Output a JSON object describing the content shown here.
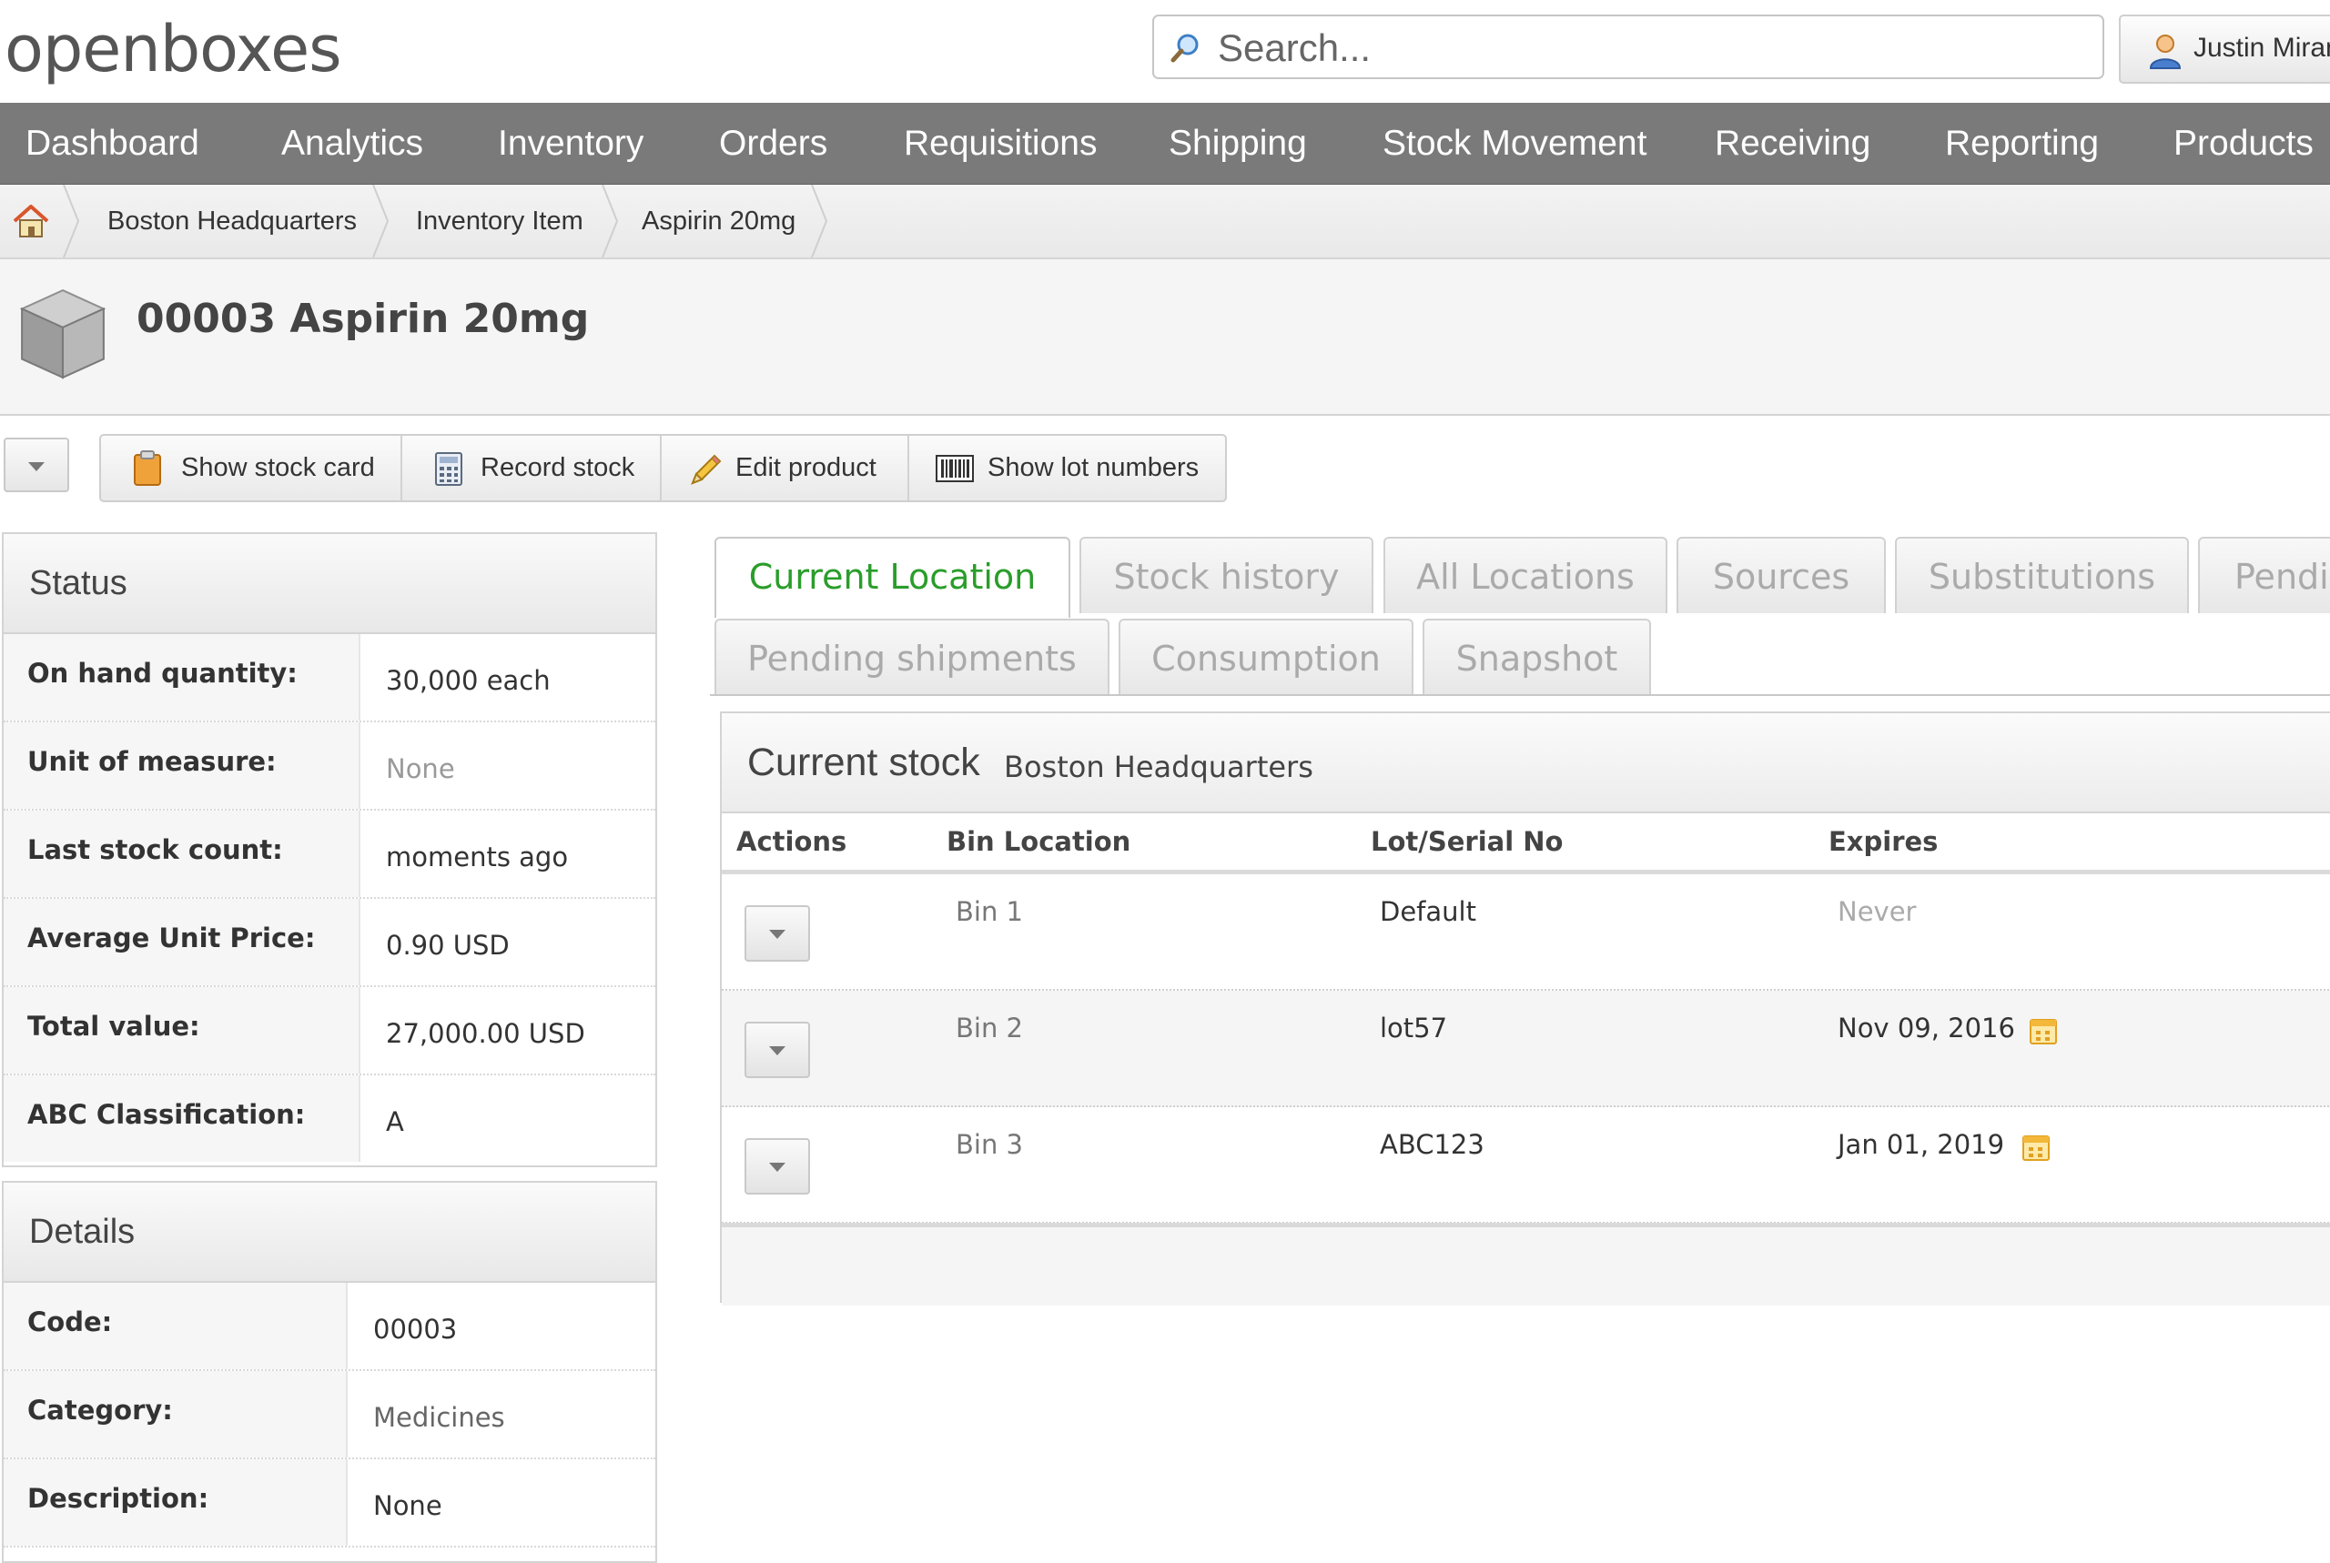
{
  "app": {
    "logo": "openboxes"
  },
  "search": {
    "placeholder": "Search..."
  },
  "user": {
    "name": "Justin Miranda"
  },
  "nav": {
    "items": [
      "Dashboard",
      "Analytics",
      "Inventory",
      "Orders",
      "Requisitions",
      "Shipping",
      "Stock Movement",
      "Receiving",
      "Reporting",
      "Products"
    ]
  },
  "breadcrumb": {
    "items": [
      "Boston Headquarters",
      "Inventory Item",
      "Aspirin 20mg"
    ]
  },
  "page": {
    "title": "00003 Aspirin 20mg"
  },
  "toolbar": {
    "show_stock_card": "Show stock card",
    "record_stock": "Record stock",
    "edit_product": "Edit product",
    "show_lot_numbers": "Show lot numbers"
  },
  "status": {
    "heading": "Status",
    "rows": [
      {
        "label": "On hand quantity:",
        "value": "30,000 each"
      },
      {
        "label": "Unit of measure:",
        "value": "None"
      },
      {
        "label": "Last stock count:",
        "value": "moments ago"
      },
      {
        "label": "Average Unit Price:",
        "value": "0.90 USD"
      },
      {
        "label": "Total value:",
        "value": "27,000.00 USD"
      },
      {
        "label": "ABC Classification:",
        "value": "A"
      }
    ]
  },
  "details": {
    "heading": "Details",
    "rows": [
      {
        "label": "Code:",
        "value": "00003"
      },
      {
        "label": "Category:",
        "value": "Medicines"
      },
      {
        "label": "Description:",
        "value": "None"
      }
    ]
  },
  "tabs": {
    "row1": [
      "Current Location",
      "Stock history",
      "All Locations",
      "Sources",
      "Substitutions",
      "Pending"
    ],
    "row2": [
      "Pending shipments",
      "Consumption",
      "Snapshot"
    ],
    "active": "Current Location"
  },
  "stock": {
    "heading": "Current stock",
    "location": "Boston Headquarters",
    "columns": [
      "Actions",
      "Bin Location",
      "Lot/Serial No",
      "Expires"
    ],
    "rows": [
      {
        "bin": "Bin 1",
        "lot": "Default",
        "expires": "Never"
      },
      {
        "bin": "Bin 2",
        "lot": "lot57",
        "expires": "Nov 09, 2016"
      },
      {
        "bin": "Bin 3",
        "lot": "ABC123",
        "expires": "Jan 01, 2019"
      }
    ]
  },
  "colors": {
    "nav_bg": "#7a7a7a",
    "active_tab_text": "#2a9d2a",
    "inactive_tab_text": "#aaaaaa"
  },
  "icons": {
    "search": "search-icon",
    "user": "user-icon",
    "home": "home-icon",
    "product": "box-icon",
    "stock_card": "clipboard-icon",
    "record_stock": "calculator-icon",
    "edit": "pencil-icon",
    "lot_numbers": "barcode-icon",
    "expiry": "calendar-icon"
  }
}
